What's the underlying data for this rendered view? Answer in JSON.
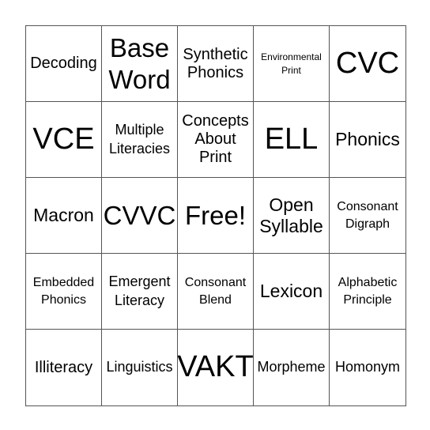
{
  "bingo": {
    "rows": [
      [
        {
          "text": "Decoding",
          "size": "fs-ms"
        },
        {
          "text": "Base Word",
          "size": "fs-l"
        },
        {
          "text": "Synthetic Phonics",
          "size": "fs-ms"
        },
        {
          "text": "Environmental Print",
          "size": "fs-xxs"
        },
        {
          "text": "CVC",
          "size": "fs-xl"
        }
      ],
      [
        {
          "text": "VCE",
          "size": "fs-xl"
        },
        {
          "text": "Multiple Literacies",
          "size": "fs-s"
        },
        {
          "text": "Concepts About Print",
          "size": "fs-ms"
        },
        {
          "text": "ELL",
          "size": "fs-xl"
        },
        {
          "text": "Phonics",
          "size": "fs-m"
        }
      ],
      [
        {
          "text": "Macron",
          "size": "fs-m"
        },
        {
          "text": "CVVC",
          "size": "fs-l"
        },
        {
          "text": "Free!",
          "size": "fs-l"
        },
        {
          "text": "Open Syllable",
          "size": "fs-m"
        },
        {
          "text": "Consonant Digraph",
          "size": "fs-xs"
        }
      ],
      [
        {
          "text": "Embedded Phonics",
          "size": "fs-xs"
        },
        {
          "text": "Emergent Literacy",
          "size": "fs-s"
        },
        {
          "text": "Consonant Blend",
          "size": "fs-xs"
        },
        {
          "text": "Lexicon",
          "size": "fs-m"
        },
        {
          "text": "Alphabetic Principle",
          "size": "fs-xs"
        }
      ],
      [
        {
          "text": "Illiteracy",
          "size": "fs-ms"
        },
        {
          "text": "Linguistics",
          "size": "fs-s"
        },
        {
          "text": "VAKT",
          "size": "fs-xl"
        },
        {
          "text": "Morpheme",
          "size": "fs-s"
        },
        {
          "text": "Homonym",
          "size": "fs-s"
        }
      ]
    ]
  }
}
